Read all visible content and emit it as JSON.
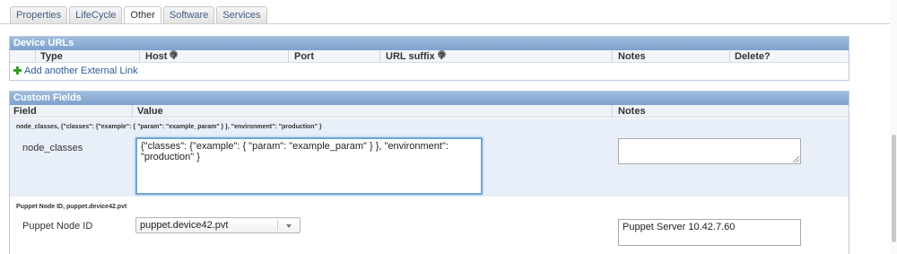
{
  "tabs": [
    {
      "label": "Properties",
      "active": false
    },
    {
      "label": "LifeCycle",
      "active": false
    },
    {
      "label": "Other",
      "active": true
    },
    {
      "label": "Software",
      "active": false
    },
    {
      "label": "Services",
      "active": false
    }
  ],
  "device_urls": {
    "title": "Device URLs",
    "columns": {
      "type": "Type",
      "host": "Host",
      "port": "Port",
      "url_suffix": "URL suffix",
      "notes": "Notes",
      "delete": "Delete?"
    },
    "add_link": "Add another External Link"
  },
  "custom_fields": {
    "title": "Custom Fields",
    "columns": {
      "field": "Field",
      "value": "Value",
      "notes": "Notes"
    },
    "groups": [
      {
        "title": "node_classes, {\"classes\": {\"example\": { \"param\": \"example_param\" } }, \"environment\": \"production\" }",
        "label": "node_classes",
        "value": "{\"classes\": {\"example\": { \"param\": \"example_param\" } }, \"environment\":\n\"production\" }",
        "notes": ""
      },
      {
        "title": "Puppet Node ID, puppet.device42.pvt",
        "label": "Puppet Node ID",
        "value": "puppet.device42.pvt",
        "notes": "Puppet Server 10.42.7.60"
      }
    ]
  },
  "colors": {
    "header_bg": "#8eb0d7",
    "link": "#2d5b96",
    "focus": "#6ea6d8"
  }
}
